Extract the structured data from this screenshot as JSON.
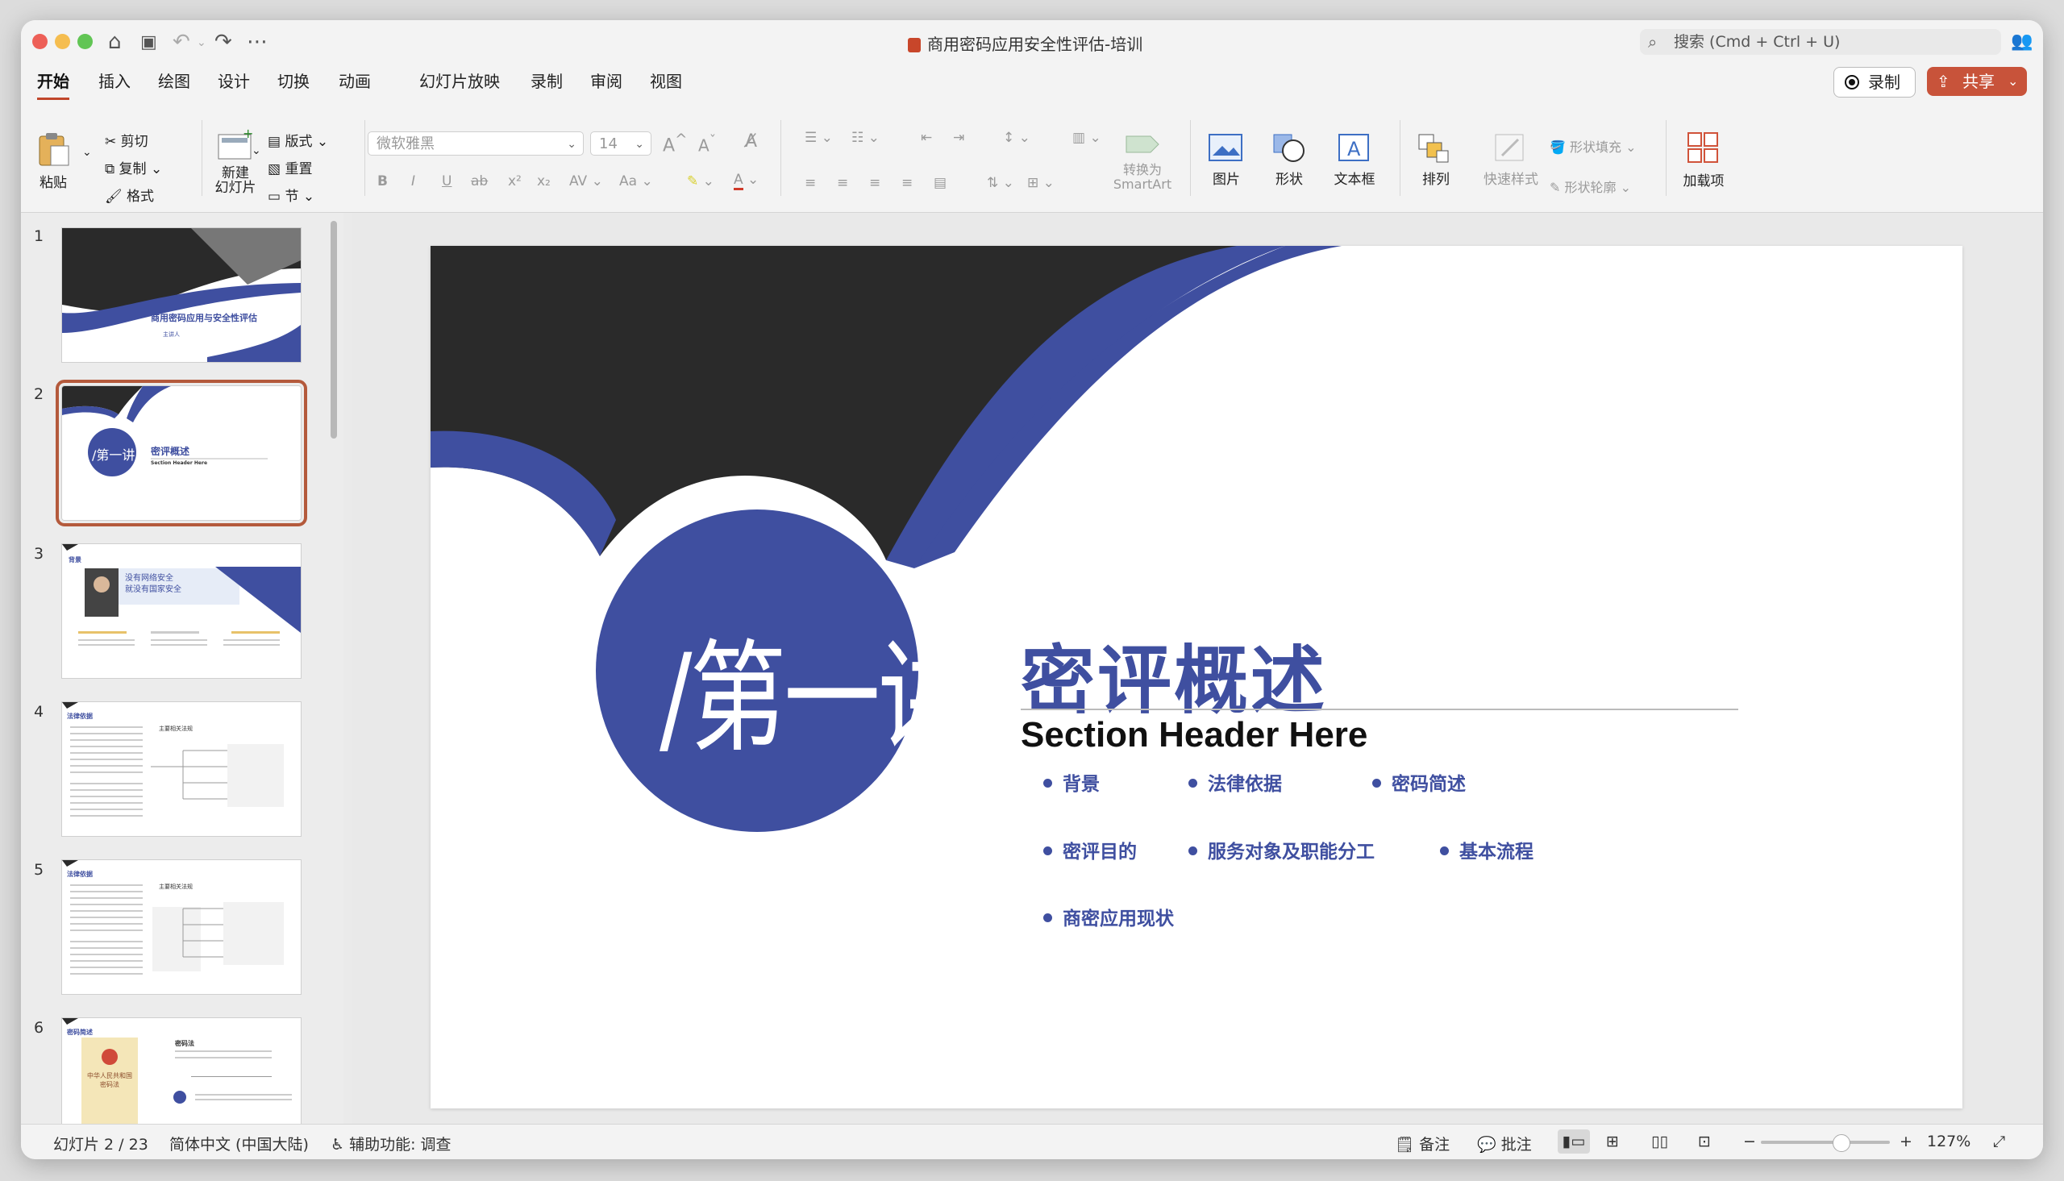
{
  "window": {
    "doc_title": "商用密码应用安全性评估-培训",
    "search_placeholder": "搜索 (Cmd + Ctrl + U)"
  },
  "tabs": [
    "开始",
    "插入",
    "绘图",
    "设计",
    "切换",
    "动画",
    "幻灯片放映",
    "录制",
    "审阅",
    "视图"
  ],
  "header_buttons": {
    "record": "录制",
    "share": "共享"
  },
  "ribbon": {
    "paste": "粘贴",
    "cut": "剪切",
    "copy": "复制",
    "format": "格式",
    "new_slide": "新建\n幻灯片",
    "layout": "版式",
    "reset": "重置",
    "section": "节",
    "font_name": "微软雅黑",
    "font_size": "14",
    "convert_smartart": "转换为\nSmartArt",
    "picture": "图片",
    "shape": "形状",
    "textbox": "文本框",
    "arrange": "排列",
    "quick_styles": "快速样式",
    "shape_fill": "形状填充",
    "shape_outline": "形状轮廓",
    "addins": "加载项"
  },
  "thumbnails": {
    "numbers": [
      "1",
      "2",
      "3",
      "4",
      "5",
      "6"
    ],
    "t1_title": "商用密码应用与安全性评估",
    "t1_presenter": "主讲人",
    "t2_circle": "/第一讲",
    "t2_title": "密评概述",
    "t2_sub": "Section Header Here",
    "t3_label": "背景",
    "t3_banner": "没有网络安全\n就没有国家安全",
    "t4_label": "法律依据",
    "t4_node": "主要相关法规",
    "t5_label": "法律依据",
    "t5_node": "主要相关法规",
    "t6_label": "密码简述",
    "t6_law_title": "中华人民共和国\n密码法",
    "t6_heading": "密码法"
  },
  "slide": {
    "circle_text": "/第一讲",
    "title": "密评概述",
    "subtitle": "Section Header Here",
    "bullets": [
      "背景",
      "法律依据",
      "密码简述",
      "密评目的",
      "服务对象及职能分工",
      "基本流程",
      "商密应用现状"
    ]
  },
  "status": {
    "slide_counter": "幻灯片 2 / 23",
    "language": "简体中文 (中国大陆)",
    "accessibility": "辅助功能: 调查",
    "notes": "备注",
    "comments": "批注",
    "zoom": "127%",
    "zoom_level": 0.62
  },
  "colors": {
    "accent_blue": "#3f4fa0",
    "dark": "#2a2a2a",
    "brand": "#c8533a"
  }
}
